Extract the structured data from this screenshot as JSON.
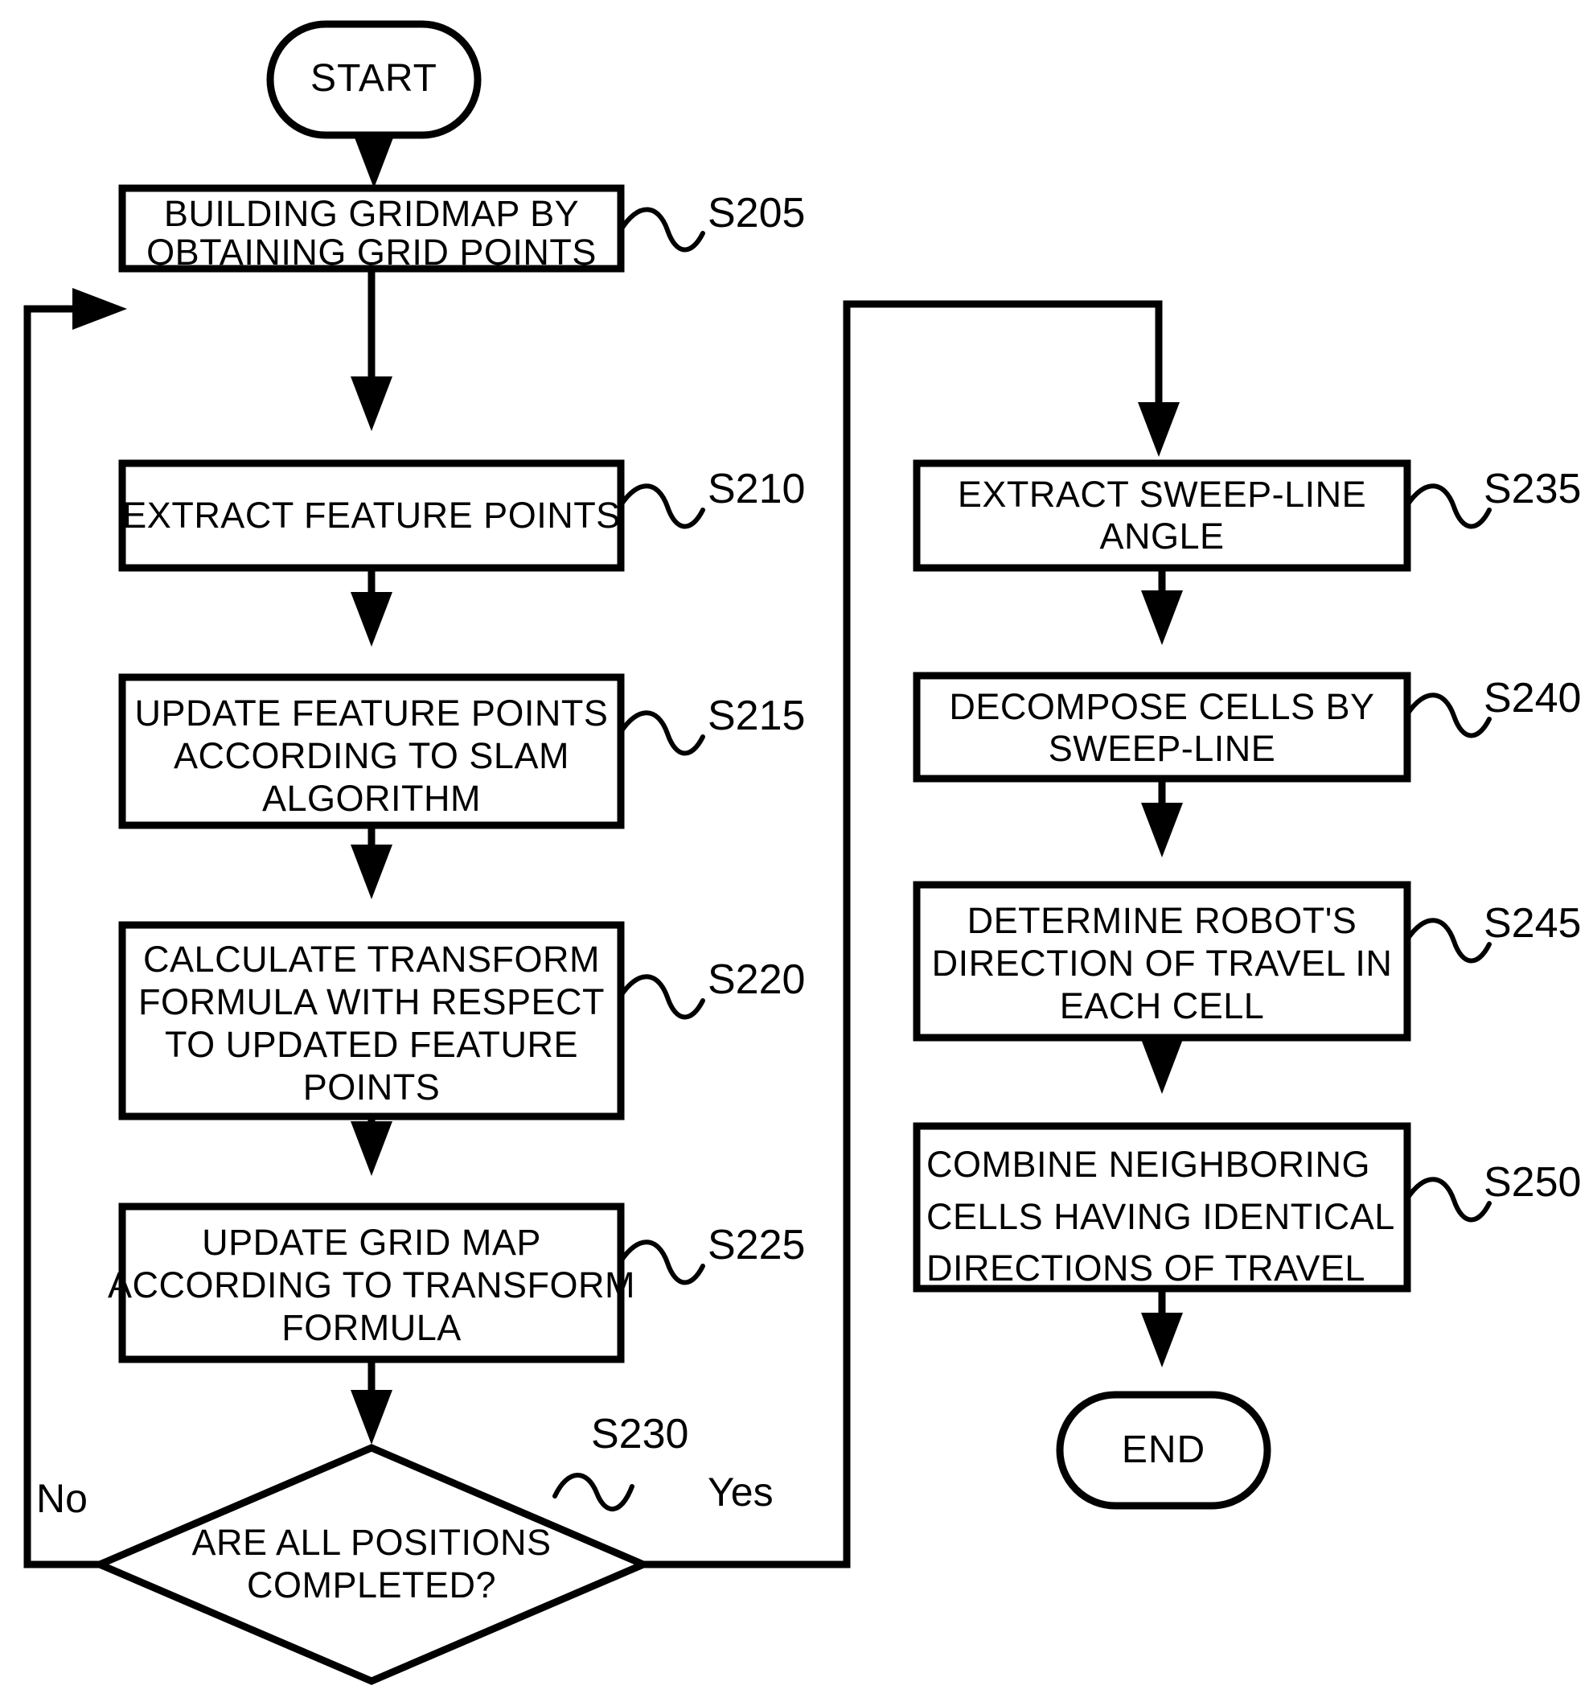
{
  "diagram": {
    "title": "SLAM gridmap and sweep-line cell decomposition flowchart",
    "start_label": "START",
    "end_label": "END",
    "decision_yes_label": "Yes",
    "decision_no_label": "No",
    "stroke_color": "#000000",
    "fill_color": "#ffffff"
  },
  "left_column": {
    "nodes": [
      {
        "id": "S205",
        "step_ref": "S205",
        "lines": [
          "BUILDING GRIDMAP BY",
          "OBTAINING GRID POINTS"
        ],
        "align": "center",
        "shape": "process"
      },
      {
        "id": "S210",
        "step_ref": "S210",
        "lines": [
          "EXTRACT FEATURE POINTS"
        ],
        "align": "center",
        "shape": "process"
      },
      {
        "id": "S215",
        "step_ref": "S215",
        "lines": [
          "UPDATE FEATURE POINTS",
          "ACCORDING TO SLAM",
          "ALGORITHM"
        ],
        "align": "center",
        "shape": "process"
      },
      {
        "id": "S220",
        "step_ref": "S220",
        "lines": [
          "CALCULATE TRANSFORM",
          "FORMULA WITH RESPECT",
          "TO UPDATED FEATURE",
          "POINTS"
        ],
        "align": "center",
        "shape": "process"
      },
      {
        "id": "S225",
        "step_ref": "S225",
        "lines": [
          "UPDATE GRID MAP",
          "ACCORDING TO TRANSFORM",
          "FORMULA"
        ],
        "align": "center",
        "shape": "process"
      },
      {
        "id": "S230",
        "step_ref": "S230",
        "lines": [
          "ARE ALL POSITIONS",
          "COMPLETED?"
        ],
        "align": "center",
        "shape": "decision"
      }
    ]
  },
  "right_column": {
    "nodes": [
      {
        "id": "S235",
        "step_ref": "S235",
        "lines": [
          "EXTRACT SWEEP-LINE",
          "ANGLE"
        ],
        "align": "center",
        "shape": "process"
      },
      {
        "id": "S240",
        "step_ref": "S240",
        "lines": [
          "DECOMPOSE CELLS BY",
          "SWEEP-LINE"
        ],
        "align": "center",
        "shape": "process"
      },
      {
        "id": "S245",
        "step_ref": "S245",
        "lines": [
          "DETERMINE ROBOT'S",
          "DIRECTION OF TRAVEL IN",
          "EACH CELL"
        ],
        "align": "center",
        "shape": "process"
      },
      {
        "id": "S250",
        "step_ref": "S250",
        "lines": [
          "COMBINE NEIGHBORING",
          "CELLS HAVING IDENTICAL",
          "DIRECTIONS OF TRAVEL"
        ],
        "align": "left",
        "shape": "process"
      }
    ]
  }
}
